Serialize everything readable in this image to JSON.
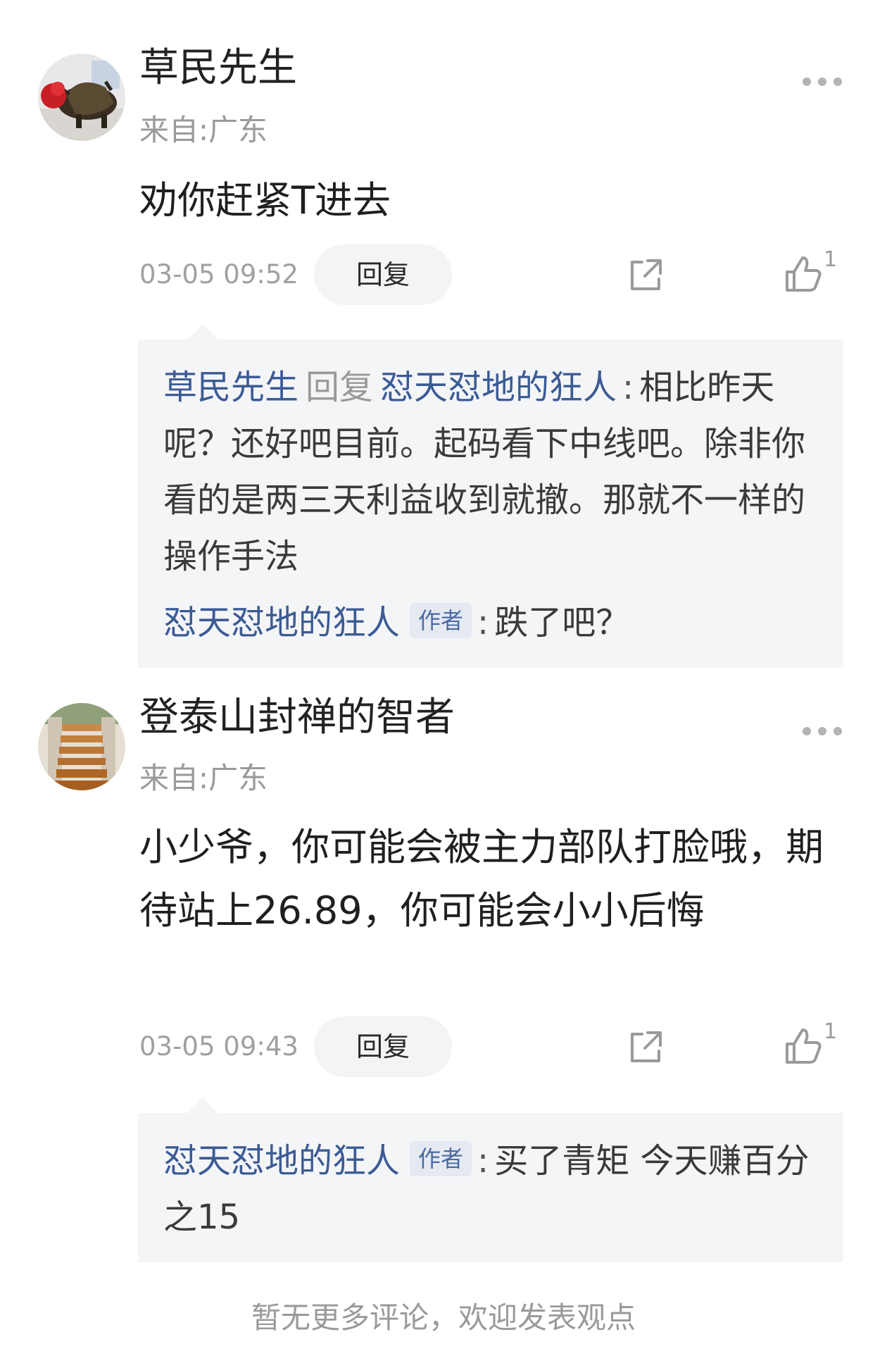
{
  "comments": [
    {
      "username": "草民先生",
      "location": "来自:广东",
      "content": "劝你赶紧T进去",
      "time": "03-05 09:52",
      "reply_label": "回复",
      "like_count": "1",
      "avatar": "bull-statue-avatar",
      "replies": [
        {
          "from": "草民先生",
          "verb": "回复",
          "to": "怼天怼地的狂人",
          "colon": ":",
          "text": "相比昨天呢？还好吧目前。起码看下中线吧。除非你看的是两三天利益收到就撤。那就不一样的操作手法"
        },
        {
          "from": "怼天怼地的狂人",
          "tag": "作者",
          "colon": ":",
          "text": "跌了吧？"
        }
      ]
    },
    {
      "username": "登泰山封禅的智者",
      "location": "来自:广东",
      "content": "小少爷，你可能会被主力部队打脸哦，期待站上26.89，你可能会小小后悔",
      "time": "03-05 09:43",
      "reply_label": "回复",
      "like_count": "1",
      "avatar": "staircase-avatar",
      "replies": [
        {
          "from": "怼天怼地的狂人",
          "tag": "作者",
          "colon": ":",
          "text": "买了青矩 今天赚百分之15"
        }
      ]
    }
  ],
  "footer_text": "暂无更多评论，欢迎发表观点",
  "colors": {
    "name_link": "#3b5b95",
    "muted": "#9a9a9a",
    "reply_bg": "#f4f5f7"
  }
}
